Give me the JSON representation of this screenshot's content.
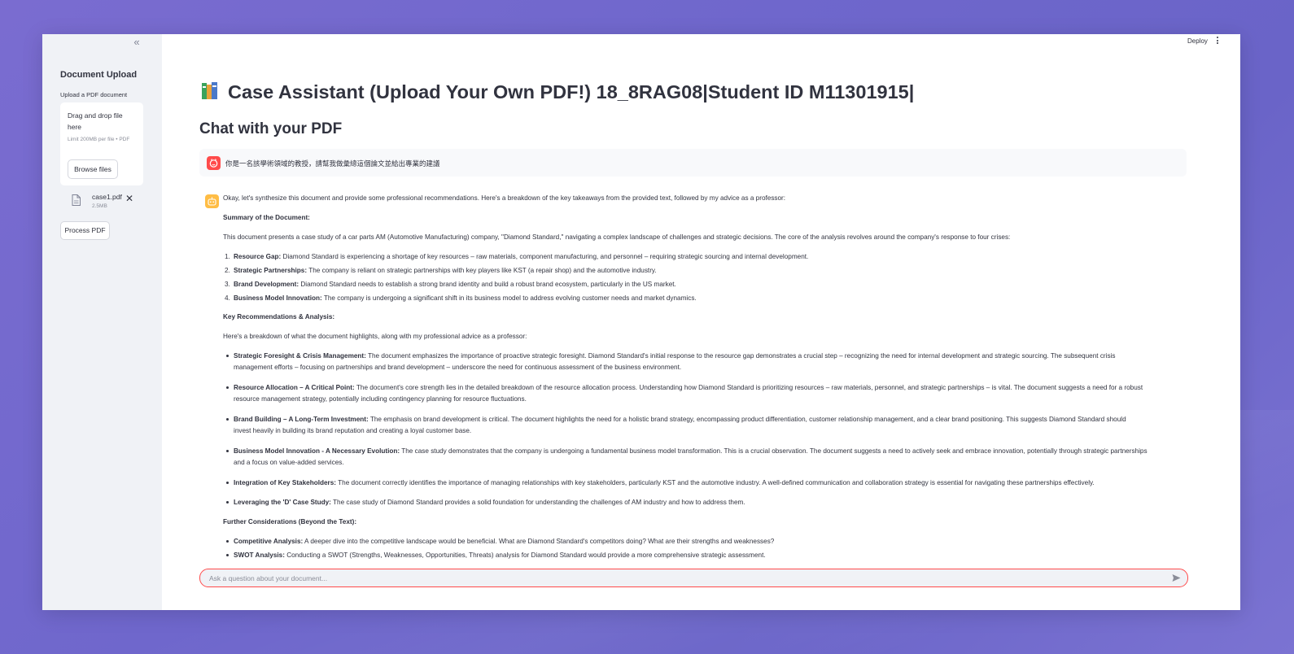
{
  "sidebar": {
    "title": "Document Upload",
    "upload_label": "Upload a PDF document",
    "dropzone_text": "Drag and drop file here",
    "dropzone_limit": "Limit 200MB per file • PDF",
    "browse_label": "Browse files",
    "file": {
      "name": "case1.pdf",
      "size": "2.5MB"
    },
    "process_label": "Process PDF"
  },
  "header": {
    "deploy_label": "Deploy"
  },
  "main": {
    "title": "Case Assistant (Upload Your Own PDF!) 18_8RAG08|Student ID M11301915|",
    "subtitle": "Chat with your PDF"
  },
  "messages": {
    "user": "你是一名該學術領域的教授，請幫我做彙總這個論文並給出專業的建議",
    "assistant": {
      "intro": "Okay, let's synthesize this document and provide some professional recommendations. Here's a breakdown of the key takeaways from the provided text, followed by my advice as a professor:",
      "summary_heading": "Summary of the Document:",
      "summary_text": "This document presents a case study of a car parts AM (Automotive Manufacturing) company, \"Diamond Standard,\" navigating a complex landscape of challenges and strategic decisions. The core of the analysis revolves around the company's response to four crises:",
      "crises": [
        {
          "num": "1.",
          "label": "Resource Gap:",
          "text": " Diamond Standard is experiencing a shortage of key resources – raw materials, component manufacturing, and personnel – requiring strategic sourcing and internal development."
        },
        {
          "num": "2.",
          "label": "Strategic Partnerships:",
          "text": " The company is reliant on strategic partnerships with key players like KST (a repair shop) and the automotive industry."
        },
        {
          "num": "3.",
          "label": "Brand Development:",
          "text": " Diamond Standard needs to establish a strong brand identity and build a robust brand ecosystem, particularly in the US market."
        },
        {
          "num": "4.",
          "label": "Business Model Innovation:",
          "text": " The company is undergoing a significant shift in its business model to address evolving customer needs and market dynamics."
        }
      ],
      "recs_heading": "Key Recommendations & Analysis:",
      "recs_intro": "Here's a breakdown of what the document highlights, along with my professional advice as a professor:",
      "recs": [
        {
          "label": "Strategic Foresight & Crisis Management:",
          "line1": " The document emphasizes the importance of proactive strategic foresight. Diamond Standard's initial response to the resource gap demonstrates a crucial step – recognizing the need for internal development and strategic sourcing. The subsequent crisis",
          "line2": "management efforts – focusing on partnerships and brand development – underscore the need for continuous assessment of the business environment."
        },
        {
          "label": "Resource Allocation – A Critical Point:",
          "line1": " The document's core strength lies in the detailed breakdown of the resource allocation process. Understanding how Diamond Standard is prioritizing resources – raw materials, personnel, and strategic partnerships – is vital. The document suggests a need for a robust",
          "line2": "resource management strategy, potentially including contingency planning for resource fluctuations."
        },
        {
          "label": "Brand Building – A Long-Term Investment:",
          "line1": " The emphasis on brand development is critical. The document highlights the need for a holistic brand strategy, encompassing product differentiation, customer relationship management, and a clear brand positioning. This suggests Diamond Standard should",
          "line2": "invest heavily in building its brand reputation and creating a loyal customer base."
        },
        {
          "label": "Business Model Innovation - A Necessary Evolution:",
          "line1": " The case study demonstrates that the company is undergoing a fundamental business model transformation. This is a crucial observation. The document suggests a need to actively seek and embrace innovation, potentially through strategic partnerships",
          "line2": "and a focus on value-added services."
        },
        {
          "label": "Integration of Key Stakeholders:",
          "line1": " The document correctly identifies the importance of managing relationships with key stakeholders, particularly KST and the automotive industry. A well-defined communication and collaboration strategy is essential for navigating these partnerships effectively.",
          "line2": ""
        },
        {
          "label": "Leveraging the 'D' Case Study:",
          "line1": " The case study of Diamond Standard provides a solid foundation for understanding the challenges of AM industry and how to address them.",
          "line2": ""
        }
      ],
      "further_heading": "Further Considerations (Beyond the Text):",
      "further": [
        {
          "label": "Competitive Analysis:",
          "text": " A deeper dive into the competitive landscape would be beneficial. What are Diamond Standard's competitors doing? What are their strengths and weaknesses?"
        },
        {
          "label": "SWOT Analysis:",
          "text": " Conducting a SWOT (Strengths, Weaknesses, Opportunities, Threats) analysis for Diamond Standard would provide a more comprehensive strategic assessment."
        }
      ]
    }
  },
  "chat_input": {
    "placeholder": "Ask a question about your document..."
  },
  "colors": {
    "accent": "#ff4b4b",
    "bot_avatar": "#ffbd45",
    "sidebar_bg": "#f0f2f6"
  }
}
